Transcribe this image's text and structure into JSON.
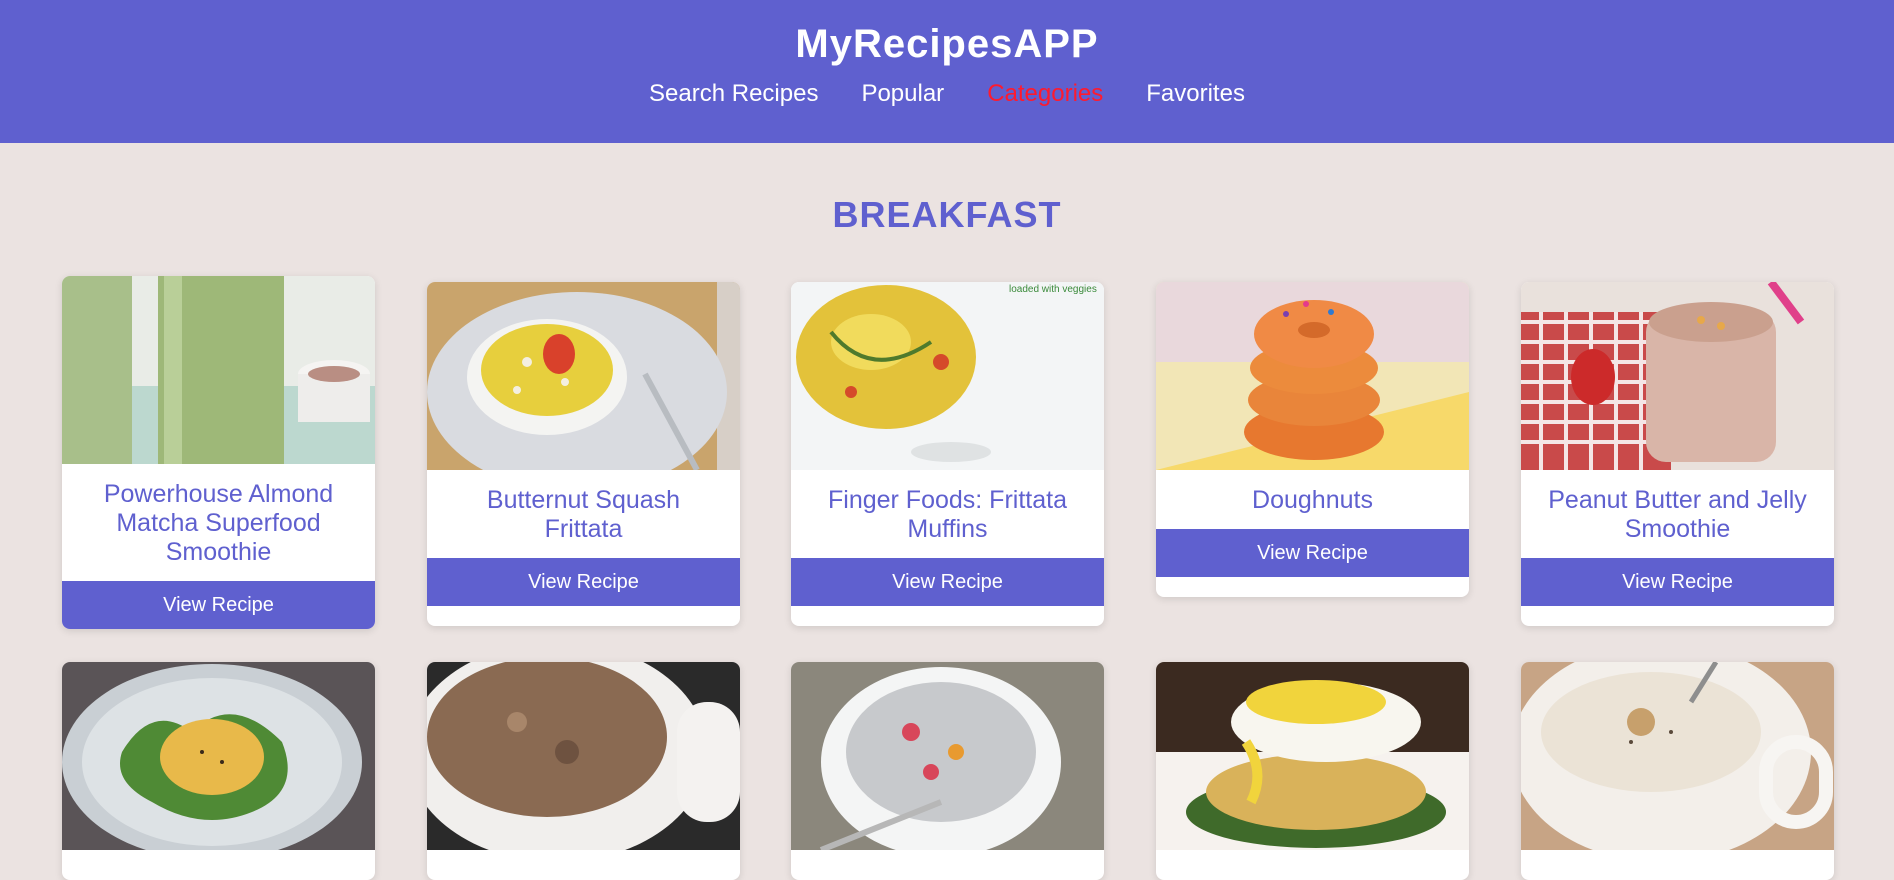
{
  "header": {
    "title": "MyRecipesAPP",
    "nav": [
      {
        "label": "Search Recipes",
        "active": false
      },
      {
        "label": "Popular",
        "active": false
      },
      {
        "label": "Categories",
        "active": true
      },
      {
        "label": "Favorites",
        "active": false
      }
    ]
  },
  "category": {
    "title": "BREAKFAST"
  },
  "recipes": [
    {
      "name": "Powerhouse Almond Matcha Superfood Smoothie",
      "button": "View Recipe"
    },
    {
      "name": "Butternut Squash Frittata",
      "button": "View Recipe"
    },
    {
      "name": "Finger Foods: Frittata Muffins",
      "button": "View Recipe"
    },
    {
      "name": "Doughnuts",
      "button": "View Recipe"
    },
    {
      "name": "Peanut Butter and Jelly Smoothie",
      "button": "View Recipe"
    },
    {
      "name": "",
      "button": ""
    },
    {
      "name": "",
      "button": ""
    },
    {
      "name": "",
      "button": ""
    },
    {
      "name": "",
      "button": ""
    },
    {
      "name": "",
      "button": ""
    }
  ],
  "image_captions": {
    "finger_foods": "loaded with veggies"
  },
  "colors": {
    "primary": "#5f60cf",
    "background": "#ebe3e1",
    "active_nav": "#ff1a2e"
  }
}
